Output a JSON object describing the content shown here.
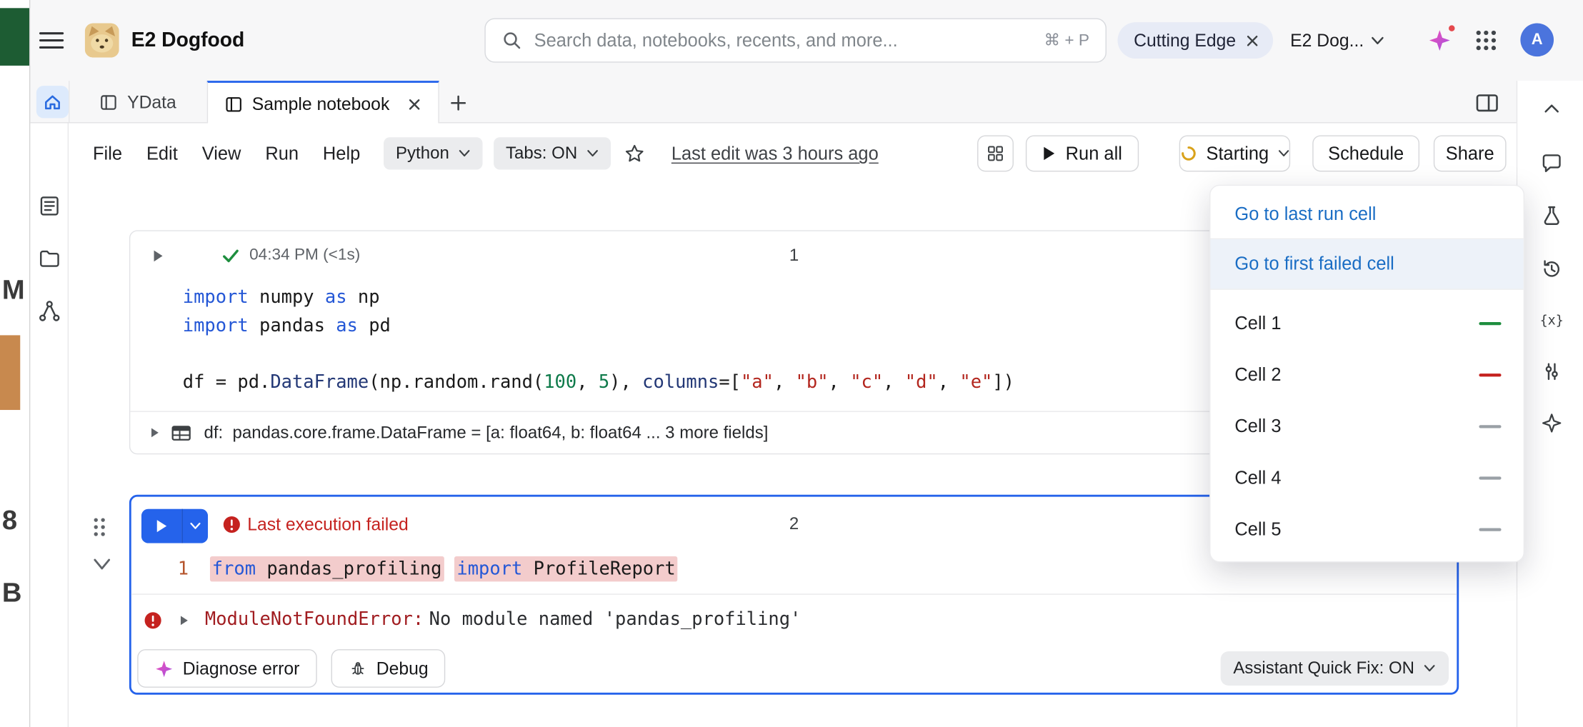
{
  "colors": {
    "accent": "#2563eb",
    "link": "#1a6dc4",
    "error": "#c5221f",
    "error_dark": "#a11d21",
    "error_bg": "#f3cccc",
    "success": "#1e8e3e",
    "keyword": "#2457d6",
    "function": "#233876",
    "number": "#0e7a4a",
    "string": "#b3261e",
    "line_number": "#b5552d",
    "spinner": "#d9a21b",
    "muted": "#5f6368"
  },
  "left_strip": {
    "letters": [
      "M",
      "8",
      "B"
    ]
  },
  "header": {
    "workspace_name": "E2 Dogfood",
    "search_placeholder": "Search data, notebooks, recents, and more...",
    "search_shortcut": "⌘ + P",
    "plan_badge": "Cutting Edge",
    "workspace_switcher": "E2 Dog...",
    "avatar_initial": "A"
  },
  "tab_bar": {
    "tabs": [
      {
        "label": "YData",
        "active": false,
        "closable": false
      },
      {
        "label": "Sample notebook",
        "active": true,
        "closable": true
      }
    ]
  },
  "toolbar": {
    "menus": [
      "File",
      "Edit",
      "View",
      "Run",
      "Help"
    ],
    "kernel_label": "Python",
    "tabs_toggle_label": "Tabs: ON",
    "last_edit": "Last edit was 3 hours ago",
    "run_all_label": "Run all",
    "status_label": "Starting",
    "schedule_label": "Schedule",
    "share_label": "Share"
  },
  "cell1": {
    "number": "1",
    "run_time": "04:34 PM (<1s)",
    "code_lines": [
      [
        {
          "t": "kw",
          "v": "import"
        },
        {
          "t": "p",
          "v": " numpy "
        },
        {
          "t": "kw",
          "v": "as"
        },
        {
          "t": "p",
          "v": " np"
        }
      ],
      [
        {
          "t": "kw",
          "v": "import"
        },
        {
          "t": "p",
          "v": " pandas "
        },
        {
          "t": "kw",
          "v": "as"
        },
        {
          "t": "p",
          "v": " pd"
        }
      ],
      [],
      [
        {
          "t": "p",
          "v": "df = pd."
        },
        {
          "t": "fn",
          "v": "DataFrame"
        },
        {
          "t": "p",
          "v": "(np.random.rand("
        },
        {
          "t": "num",
          "v": "100"
        },
        {
          "t": "p",
          "v": ", "
        },
        {
          "t": "num",
          "v": "5"
        },
        {
          "t": "p",
          "v": "), "
        },
        {
          "t": "fn",
          "v": "columns"
        },
        {
          "t": "p",
          "v": "=["
        },
        {
          "t": "str",
          "v": "\"a\""
        },
        {
          "t": "p",
          "v": ", "
        },
        {
          "t": "str",
          "v": "\"b\""
        },
        {
          "t": "p",
          "v": ", "
        },
        {
          "t": "str",
          "v": "\"c\""
        },
        {
          "t": "p",
          "v": ", "
        },
        {
          "t": "str",
          "v": "\"d\""
        },
        {
          "t": "p",
          "v": ", "
        },
        {
          "t": "str",
          "v": "\"e\""
        },
        {
          "t": "p",
          "v": "])"
        }
      ]
    ],
    "output_text": "df:  pandas.core.frame.DataFrame = [a: float64, b: float64 ... 3 more fields]"
  },
  "cell2": {
    "number": "2",
    "status_text": "Last execution failed",
    "line_number": "1",
    "code_segments": [
      [
        {
          "t": "kw",
          "v": "from"
        },
        {
          "t": "p",
          "v": " pandas_profiling"
        }
      ],
      [
        {
          "t": "kw",
          "v": "import"
        },
        {
          "t": "p",
          "v": " ProfileReport"
        }
      ]
    ],
    "error_type": "ModuleNotFoundError:",
    "error_message": "No module named 'pandas_profiling'",
    "diagnose_label": "Diagnose error",
    "debug_label": "Debug",
    "quick_fix_label": "Assistant Quick Fix: ON"
  },
  "goto_dropdown": {
    "actions": [
      {
        "label": "Go to last run cell",
        "highlighted": false
      },
      {
        "label": "Go to first failed cell",
        "highlighted": true
      }
    ],
    "cells": [
      {
        "label": "Cell 1",
        "status": "success"
      },
      {
        "label": "Cell 2",
        "status": "error"
      },
      {
        "label": "Cell 3",
        "status": "none"
      },
      {
        "label": "Cell 4",
        "status": "none"
      },
      {
        "label": "Cell 5",
        "status": "none"
      }
    ]
  }
}
